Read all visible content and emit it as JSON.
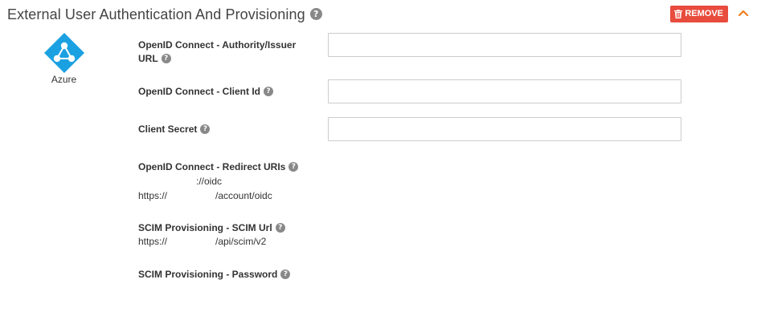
{
  "header": {
    "title": "External User Authentication And Provisioning",
    "help": "?",
    "remove_label": "REMOVE",
    "remove_color": "#e84c3d"
  },
  "provider": {
    "name": "Azure",
    "logo_color": "#1ba1e2"
  },
  "fields": {
    "authority": {
      "label_line1": "OpenID Connect - Authority/Issuer",
      "label_line2": "URL",
      "value": ""
    },
    "client_id": {
      "label": "OpenID Connect - Client Id",
      "value": ""
    },
    "client_secret": {
      "label": "Client Secret",
      "value": ""
    },
    "redirect_uris": {
      "label": "OpenID Connect - Redirect URIs",
      "line1": "://oidc",
      "line2_prefix": "https://",
      "line2_suffix": "/account/oidc"
    },
    "scim_url": {
      "label": "SCIM Provisioning - SCIM Url",
      "prefix": "https://",
      "suffix": "/api/scim/v2"
    },
    "scim_password": {
      "label": "SCIM Provisioning - Password"
    }
  }
}
